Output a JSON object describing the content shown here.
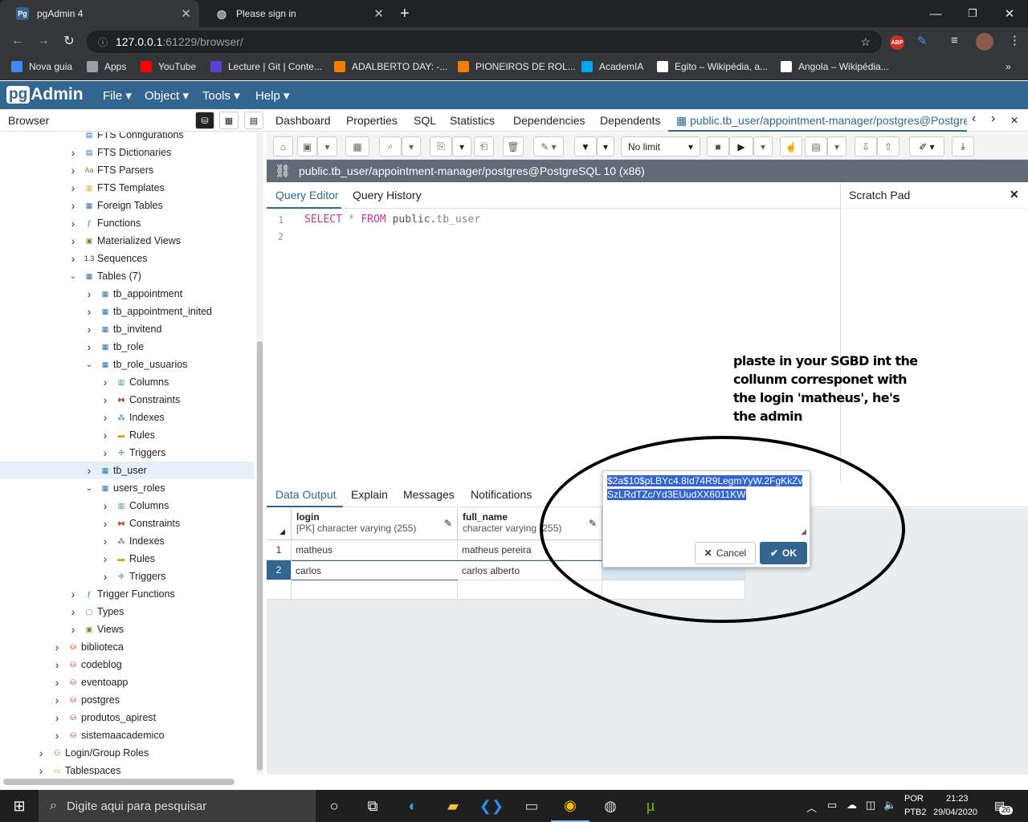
{
  "chrome": {
    "tabs": [
      {
        "title": "pgAdmin 4",
        "icon": "Pg"
      },
      {
        "title": "Please sign in",
        "icon": "globe-icon"
      }
    ],
    "url_host": "127.0.0.1",
    "url_rest": ":61229/browser/",
    "bookmarks": [
      {
        "label": "Nova guia",
        "color": "#4285f4"
      },
      {
        "label": "Apps",
        "color": "#9aa0a6"
      },
      {
        "label": "YouTube",
        "color": "#ff0000"
      },
      {
        "label": "Lecture | Git | Conte...",
        "color": "#5a3fd0"
      },
      {
        "label": "ADALBERTO DAY: -...",
        "color": "#f57d00"
      },
      {
        "label": "PIONEIROS DE ROL...",
        "color": "#f57d00"
      },
      {
        "label": "AcademIA",
        "color": "#00a4ef"
      },
      {
        "label": "Egito – Wikipédia, a...",
        "color": "#ffffff"
      },
      {
        "label": "Angola – Wikipédia...",
        "color": "#ffffff"
      }
    ]
  },
  "pgadmin": {
    "logo_pg": "pg",
    "logo_rest": "Admin",
    "menus": [
      "File",
      "Object",
      "Tools",
      "Help"
    ],
    "browser_title": "Browser",
    "tree": [
      {
        "label": "FTS Configurations",
        "indent": 2,
        "icon": "fts-icon",
        "exp": "none"
      },
      {
        "label": "FTS Dictionaries",
        "indent": 2,
        "icon": "fts-icon",
        "exp": "closed"
      },
      {
        "label": "FTS Parsers",
        "indent": 2,
        "icon": "fts-parser-icon",
        "exp": "closed"
      },
      {
        "label": "FTS Templates",
        "indent": 2,
        "icon": "fts-template-icon",
        "exp": "closed"
      },
      {
        "label": "Foreign Tables",
        "indent": 2,
        "icon": "table-icon",
        "exp": "closed"
      },
      {
        "label": "Functions",
        "indent": 2,
        "icon": "function-icon",
        "exp": "closed"
      },
      {
        "label": "Materialized Views",
        "indent": 2,
        "icon": "view-icon",
        "exp": "closed"
      },
      {
        "label": "Sequences",
        "indent": 2,
        "icon": "sequence-icon",
        "exp": "closed"
      },
      {
        "label": "Tables (7)",
        "indent": 2,
        "icon": "table-icon",
        "exp": "open"
      },
      {
        "label": "tb_appointment",
        "indent": 3,
        "icon": "table-icon",
        "exp": "closed"
      },
      {
        "label": "tb_appointment_inited",
        "indent": 3,
        "icon": "table-icon",
        "exp": "closed"
      },
      {
        "label": "tb_invitend",
        "indent": 3,
        "icon": "table-icon",
        "exp": "closed"
      },
      {
        "label": "tb_role",
        "indent": 3,
        "icon": "table-icon",
        "exp": "closed"
      },
      {
        "label": "tb_role_usuarios",
        "indent": 3,
        "icon": "table-icon",
        "exp": "open"
      },
      {
        "label": "Columns",
        "indent": 4,
        "icon": "columns-icon",
        "exp": "closed"
      },
      {
        "label": "Constraints",
        "indent": 4,
        "icon": "constraints-icon",
        "exp": "closed"
      },
      {
        "label": "Indexes",
        "indent": 4,
        "icon": "indexes-icon",
        "exp": "closed"
      },
      {
        "label": "Rules",
        "indent": 4,
        "icon": "rules-icon",
        "exp": "closed"
      },
      {
        "label": "Triggers",
        "indent": 4,
        "icon": "triggers-icon",
        "exp": "closed"
      },
      {
        "label": "tb_user",
        "indent": 3,
        "icon": "table-icon",
        "exp": "closed",
        "selected": true
      },
      {
        "label": "users_roles",
        "indent": 3,
        "icon": "table-icon",
        "exp": "open"
      },
      {
        "label": "Columns",
        "indent": 4,
        "icon": "columns-icon",
        "exp": "closed"
      },
      {
        "label": "Constraints",
        "indent": 4,
        "icon": "constraints-icon",
        "exp": "closed"
      },
      {
        "label": "Indexes",
        "indent": 4,
        "icon": "indexes-icon",
        "exp": "closed"
      },
      {
        "label": "Rules",
        "indent": 4,
        "icon": "rules-icon",
        "exp": "closed"
      },
      {
        "label": "Triggers",
        "indent": 4,
        "icon": "triggers-icon",
        "exp": "closed"
      },
      {
        "label": "Trigger Functions",
        "indent": 2,
        "icon": "function-icon",
        "exp": "closed"
      },
      {
        "label": "Types",
        "indent": 2,
        "icon": "types-icon",
        "exp": "closed"
      },
      {
        "label": "Views",
        "indent": 2,
        "icon": "view-icon",
        "exp": "closed"
      },
      {
        "label": "biblioteca",
        "indent": 1,
        "icon": "database-icon",
        "exp": "closed"
      },
      {
        "label": "codeblog",
        "indent": 1,
        "icon": "database-icon",
        "exp": "closed"
      },
      {
        "label": "eventoapp",
        "indent": 1,
        "icon": "database-icon",
        "exp": "closed"
      },
      {
        "label": "postgres",
        "indent": 1,
        "icon": "database-icon",
        "exp": "closed"
      },
      {
        "label": "produtos_apirest",
        "indent": 1,
        "icon": "database-icon",
        "exp": "closed"
      },
      {
        "label": "sistemaacademico",
        "indent": 1,
        "icon": "database-icon",
        "exp": "closed"
      },
      {
        "label": "Login/Group Roles",
        "indent": 0,
        "icon": "roles-icon",
        "exp": "closed"
      },
      {
        "label": "Tablespaces",
        "indent": 0,
        "icon": "tablespace-icon",
        "exp": "closed"
      }
    ],
    "panel_tabs": [
      "Dashboard",
      "Properties",
      "SQL",
      "Statistics",
      "Dependencies",
      "Dependents"
    ],
    "active_tab": "public.tb_user/appointment-manager/postgres@PostgreSQL 10 (x86)",
    "no_limit": "No limit",
    "connection": "public.tb_user/appointment-manager/postgres@PostgreSQL 10 (x86)",
    "editor_tabs": [
      "Query Editor",
      "Query History"
    ],
    "scratch_title": "Scratch Pad",
    "code_line1": [
      "SELECT",
      " * ",
      "FROM",
      " public.",
      "tb_user"
    ],
    "line_numbers": [
      "1",
      "2"
    ],
    "output_tabs": [
      "Data Output",
      "Explain",
      "Messages",
      "Notifications"
    ],
    "columns": [
      {
        "name": "login",
        "type": "[PK] character varying (255)"
      },
      {
        "name": "full_name",
        "type": "character varying (255)"
      }
    ],
    "rows": [
      {
        "n": "1",
        "login": "matheus",
        "full_name": "matheus pereira"
      },
      {
        "n": "2",
        "login": "carlos",
        "full_name": "carlos alberto"
      }
    ],
    "popup_value": "$2a$10$pLBYc4.8Id74R9LegmYyW.2FgKkZvSzLRdTZc/Yd3EUudXX6011KW",
    "cancel": "Cancel",
    "ok": "OK"
  },
  "annotation": "plaste in your SGBD int the collunm corresponet with the login 'matheus', he's the admin",
  "taskbar": {
    "search": "Digite aqui para pesquisar",
    "lang1": "POR",
    "lang2": "PTB2",
    "time": "21:23",
    "date": "29/04/2020",
    "notifications": "26"
  }
}
